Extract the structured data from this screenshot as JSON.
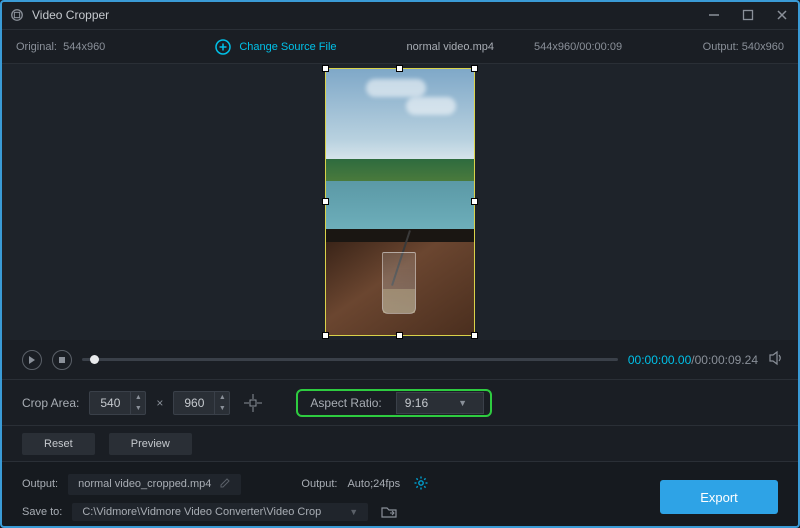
{
  "window": {
    "title": "Video Cropper"
  },
  "infobar": {
    "original_label": "Original:",
    "original_dims": "544x960",
    "change_source": "Change Source File",
    "filename": "normal video.mp4",
    "source_info": "544x960/00:00:09",
    "output_label": "Output:",
    "output_dims": "540x960"
  },
  "playback": {
    "current": "00:00:00.00",
    "total": "00:00:09.24"
  },
  "controls": {
    "crop_area_label": "Crop Area:",
    "width": "540",
    "height": "960",
    "aspect_label": "Aspect Ratio:",
    "aspect_value": "9:16",
    "reset": "Reset",
    "preview": "Preview"
  },
  "output": {
    "output_label": "Output:",
    "output_file": "normal video_cropped.mp4",
    "format_label": "Output:",
    "format_value": "Auto;24fps",
    "saveto_label": "Save to:",
    "saveto_path": "C:\\Vidmore\\Vidmore Video Converter\\Video Crop",
    "export": "Export"
  }
}
